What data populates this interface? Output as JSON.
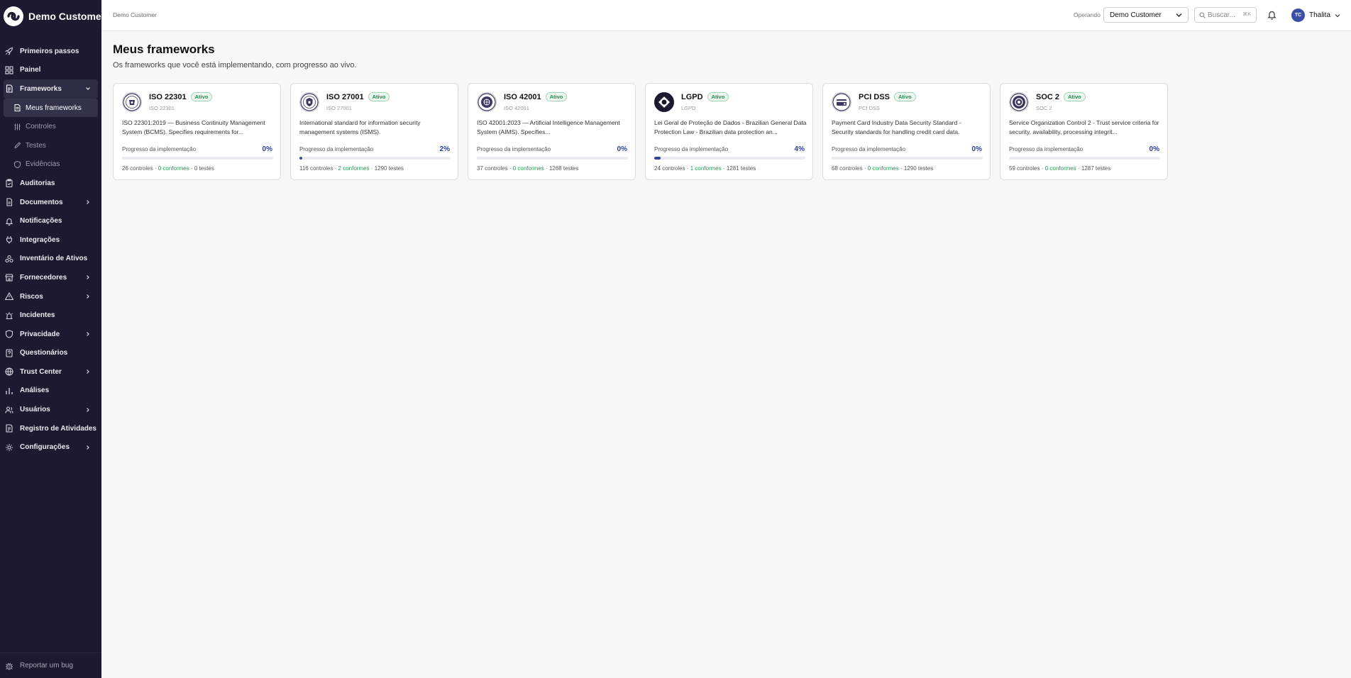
{
  "app": {
    "name": "Demo Customer"
  },
  "sidebar": {
    "items": [
      {
        "label": "Primeiros passos",
        "icon": "rocket-icon"
      },
      {
        "label": "Painel",
        "icon": "dashboard-icon"
      },
      {
        "label": "Frameworks",
        "icon": "frameworks-icon",
        "expanded": true,
        "children": [
          {
            "label": "Meus frameworks",
            "icon": "document-icon",
            "active": true
          },
          {
            "label": "Controles",
            "icon": "sliders-icon"
          },
          {
            "label": "Testes",
            "icon": "pencil-icon"
          },
          {
            "label": "Evidências",
            "icon": "shield-icon"
          }
        ]
      },
      {
        "label": "Auditorias",
        "icon": "clipboard-check-icon"
      },
      {
        "label": "Documentos",
        "icon": "documents-icon",
        "has_children": true
      },
      {
        "label": "Notificações",
        "icon": "bell-icon"
      },
      {
        "label": "Integrações",
        "icon": "plug-icon"
      },
      {
        "label": "Inventário de Ativos",
        "icon": "assets-icon"
      },
      {
        "label": "Fornecedores",
        "icon": "vendors-icon",
        "has_children": true
      },
      {
        "label": "Riscos",
        "icon": "warning-icon",
        "has_children": true
      },
      {
        "label": "Incidentes",
        "icon": "siren-icon"
      },
      {
        "label": "Privacidade",
        "icon": "privacy-shield-icon",
        "has_children": true
      },
      {
        "label": "Questionários",
        "icon": "questionnaire-icon"
      },
      {
        "label": "Trust Center",
        "icon": "globe-icon",
        "has_children": true
      },
      {
        "label": "Análises",
        "icon": "bar-chart-icon"
      },
      {
        "label": "Usuários",
        "icon": "users-icon",
        "has_children": true
      },
      {
        "label": "Registro de Atividades",
        "icon": "activity-log-icon"
      },
      {
        "label": "Configurações",
        "icon": "gear-icon",
        "has_children": true
      }
    ],
    "report_bug": "Reportar um bug"
  },
  "topbar": {
    "breadcrumb": "Demo Customer",
    "operando_label": "Operando",
    "org_selected": "Demo Customer",
    "search_placeholder": "Buscar...",
    "search_shortcut": "⌘K",
    "user_initials": "TC",
    "user_name": "Thalita"
  },
  "page": {
    "title": "Meus frameworks",
    "subtitle": "Os frameworks que você está implementando, com progresso ao vivo."
  },
  "colors": {
    "accent": "#3543a0",
    "success": "#1f9a55",
    "sidebar_bg": "#1c1930"
  },
  "frameworks": [
    {
      "name": "ISO 22301",
      "code": "ISO 22301",
      "status": "Ativo",
      "description": "ISO 22301:2019 — Business Continuity Management System (BCMS). Specifies requirements for...",
      "progress_label": "Progresso da implementação",
      "progress_text": "0%",
      "progress": 0,
      "controls": "26 controles",
      "conformes": "0 conformes",
      "tests": "0 testes"
    },
    {
      "name": "ISO 27001",
      "code": "ISO 27001",
      "status": "Ativo",
      "description": "International standard for information security management systems (ISMS).",
      "progress_label": "Progresso da implementação",
      "progress_text": "2%",
      "progress": 2,
      "controls": "116 controles",
      "conformes": "2 conformes",
      "tests": "1290 testes"
    },
    {
      "name": "ISO 42001",
      "code": "ISO 42001",
      "status": "Ativo",
      "description": "ISO 42001:2023 — Artificial Intelligence Management System (AIMS). Specifies...",
      "progress_label": "Progresso da implementação",
      "progress_text": "0%",
      "progress": 0,
      "controls": "37 controles",
      "conformes": "0 conformes",
      "tests": "1268 testes"
    },
    {
      "name": "LGPD",
      "code": "LGPD",
      "status": "Ativo",
      "description": "Lei Geral de Proteção de Dados - Brazilian General Data Protection Law - Brazilian data protection an...",
      "progress_label": "Progresso da implementação",
      "progress_text": "4%",
      "progress": 4,
      "controls": "24 controles",
      "conformes": "1 conformes",
      "tests": "1281 testes"
    },
    {
      "name": "PCI DSS",
      "code": "PCI DSS",
      "status": "Ativo",
      "description": "Payment Card Industry Data Security Standard - Security standards for handling credit card data.",
      "progress_label": "Progresso da implementação",
      "progress_text": "0%",
      "progress": 0,
      "controls": "68 controles",
      "conformes": "0 conformes",
      "tests": "1290 testes"
    },
    {
      "name": "SOC 2",
      "code": "SOC 2",
      "status": "Ativo",
      "description": "Service Organization Control 2 - Trust service criteria for security, availability, processing integrit...",
      "progress_label": "Progresso da implementação",
      "progress_text": "0%",
      "progress": 0,
      "controls": "59 controles",
      "conformes": "0 conformes",
      "tests": "1287 testes"
    }
  ]
}
